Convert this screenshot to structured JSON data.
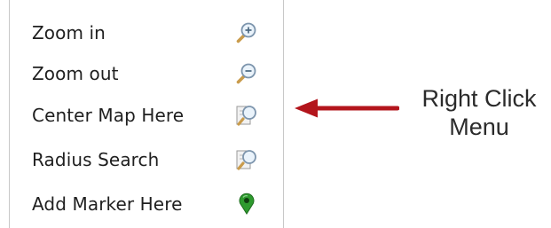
{
  "menu": {
    "items": [
      {
        "label": "Zoom in",
        "icon": "zoom-in-icon"
      },
      {
        "label": "Zoom out",
        "icon": "zoom-out-icon"
      },
      {
        "label": "Center Map Here",
        "icon": "center-map-icon"
      },
      {
        "label": "Radius Search",
        "icon": "radius-search-icon"
      },
      {
        "label": "Add Marker Here",
        "icon": "map-marker-icon"
      }
    ]
  },
  "annotation": {
    "line1": "Right Click",
    "line2": "Menu"
  },
  "colors": {
    "menu_border": "#c8c8c8",
    "arrow": "#b3151c",
    "marker": "#2e9a2e",
    "magnifier_handle": "#c99b4b"
  }
}
